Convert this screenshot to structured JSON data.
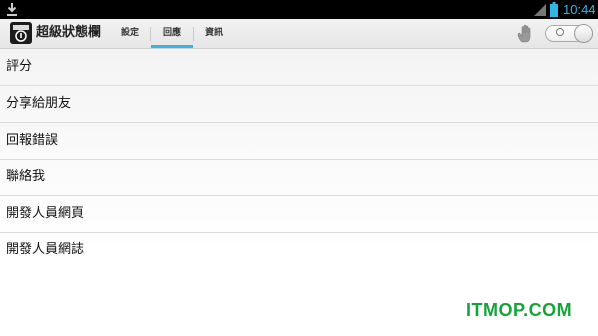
{
  "status_bar": {
    "time": "10:44",
    "icons": [
      "download-icon",
      "signal-icon",
      "battery-icon"
    ],
    "clock_color": "#33b5e5"
  },
  "action_bar": {
    "app_title": "超級狀態欄",
    "app_icon": "app-icon",
    "tabs": [
      {
        "label": "設定",
        "selected": false
      },
      {
        "label": "回應",
        "selected": true
      },
      {
        "label": "資訊",
        "selected": false
      }
    ],
    "hand_icon": "hand-icon",
    "toggle": {
      "state": "off",
      "icon": "toggle-switch"
    },
    "accent_color": "#33b5e5"
  },
  "list": {
    "items": [
      {
        "label": "評分"
      },
      {
        "label": "分享給朋友"
      },
      {
        "label": "回報錯誤"
      },
      {
        "label": "聯絡我"
      },
      {
        "label": "開發人員網頁"
      },
      {
        "label": "開發人員網誌"
      }
    ]
  },
  "watermark": {
    "text": "ITMOP.COM",
    "color": "#15a43a"
  }
}
